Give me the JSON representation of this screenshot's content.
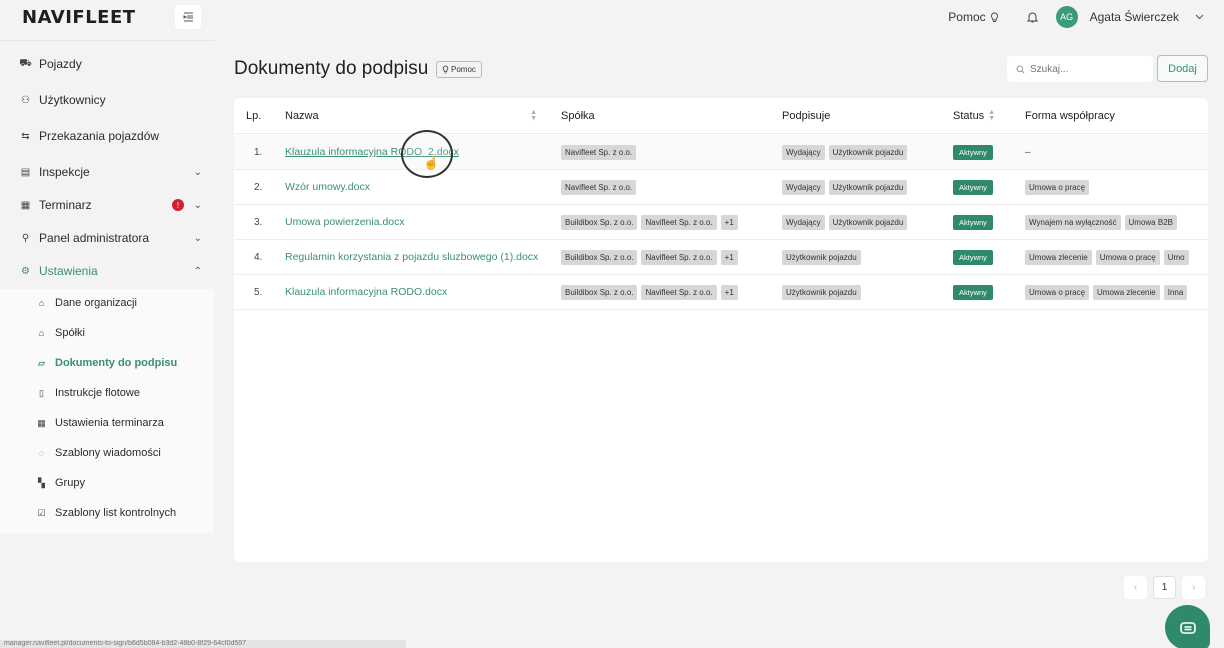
{
  "app": {
    "logo": "NAVIFLEET"
  },
  "topbar": {
    "help_label": "Pomoc",
    "avatar_initials": "AG",
    "user_name": "Agata Świerczek"
  },
  "sidebar": {
    "items": [
      {
        "label": "Pojazdy",
        "icon": "car-icon"
      },
      {
        "label": "Użytkownicy",
        "icon": "users-icon"
      },
      {
        "label": "Przekazania pojazdów",
        "icon": "swap-icon"
      },
      {
        "label": "Inspekcje",
        "icon": "clipboard-icon"
      },
      {
        "label": "Terminarz",
        "icon": "calendar-icon",
        "alert": "!"
      },
      {
        "label": "Panel administratora",
        "icon": "admin-icon"
      },
      {
        "label": "Ustawienia",
        "icon": "gear-icon"
      }
    ],
    "subitems": [
      {
        "label": "Dane organizacji",
        "icon": "bank-icon"
      },
      {
        "label": "Spółki",
        "icon": "home-icon"
      },
      {
        "label": "Dokumenty do podpisu",
        "icon": "folder-icon"
      },
      {
        "label": "Instrukcje flotowe",
        "icon": "file-icon"
      },
      {
        "label": "Ustawienia terminarza",
        "icon": "calendar-icon"
      },
      {
        "label": "Szablony wiadomości",
        "icon": "chat-icon"
      },
      {
        "label": "Grupy",
        "icon": "grid-icon"
      },
      {
        "label": "Szablony list kontrolnych",
        "icon": "checkbox-icon"
      }
    ]
  },
  "main": {
    "title": "Dokumenty do podpisu",
    "help_chip": "Pomoc",
    "search_placeholder": "Szukaj...",
    "add_button": "Dodaj"
  },
  "table": {
    "headers": {
      "lp": "Lp.",
      "name": "Nazwa",
      "company": "Spółka",
      "signer": "Podpisuje",
      "status": "Status",
      "form": "Forma współpracy"
    },
    "rows": [
      {
        "lp": "1.",
        "name": "Klauzula informacyjna RODO_2.docx",
        "companies": [
          "Navifleet Sp. z o.o."
        ],
        "signers": [
          "Wydający",
          "Użytkownik pojazdu"
        ],
        "status": "Aktywny",
        "forms": [],
        "form_text": "–"
      },
      {
        "lp": "2.",
        "name": "Wzór umowy.docx",
        "companies": [
          "Navifleet Sp. z o.o."
        ],
        "signers": [
          "Wydający",
          "Użytkownik pojazdu"
        ],
        "status": "Aktywny",
        "forms": [
          "Umowa o pracę"
        ]
      },
      {
        "lp": "3.",
        "name": "Umowa powierzenia.docx",
        "companies": [
          "Buildibox Sp. z o.o.",
          "Navifleet Sp. z o.o.",
          "+1"
        ],
        "signers": [
          "Wydający",
          "Użytkownik pojazdu"
        ],
        "status": "Aktywny",
        "forms": [
          "Wynajem na wyłączność",
          "Umowa B2B"
        ]
      },
      {
        "lp": "4.",
        "name": "Regulamin korzystania z pojazdu sluzbowego (1).docx",
        "companies": [
          "Buildibox Sp. z o.o.",
          "Navifleet Sp. z o.o.",
          "+1"
        ],
        "signers": [
          "Użytkownik pojazdu"
        ],
        "status": "Aktywny",
        "forms": [
          "Umowa zlecenie",
          "Umowa o pracę",
          "Umo"
        ]
      },
      {
        "lp": "5.",
        "name": "Klauzula informacyjna RODO.docx",
        "companies": [
          "Buildibox Sp. z o.o.",
          "Navifleet Sp. z o.o.",
          "+1"
        ],
        "signers": [
          "Użytkownik pojazdu"
        ],
        "status": "Aktywny",
        "forms": [
          "Umowa o pracę",
          "Umowa zlecenie",
          "Inna"
        ]
      }
    ]
  },
  "pagination": {
    "prev": "‹",
    "current": "1",
    "next": "›"
  },
  "statusbar": {
    "url": "manager.navifleet.pl/documents-to-sign/b6d5b084-b3d2-48b0-8f29-64cf0d597"
  }
}
